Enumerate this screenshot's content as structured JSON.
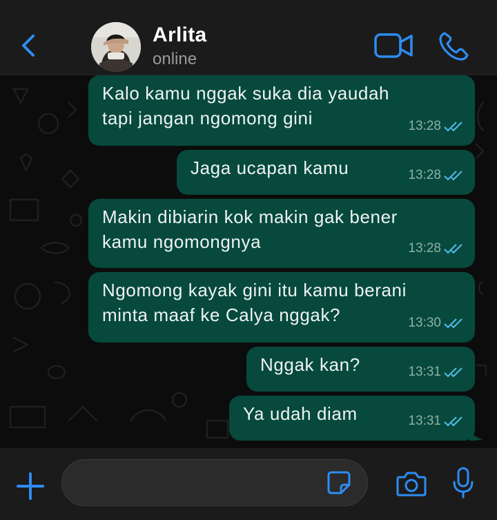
{
  "header": {
    "contact_name": "Arlita",
    "status": "online",
    "icons": {
      "back": "chevron-left-icon",
      "video": "video-camera-icon",
      "call": "phone-icon"
    }
  },
  "messages": [
    {
      "lines": [
        "Kalo kamu nggak suka dia yaudah",
        "tapi jangan ngomong gini"
      ],
      "time": "13:28",
      "status": "read"
    },
    {
      "lines": [
        "Jaga ucapan kamu"
      ],
      "time": "13:28",
      "status": "read"
    },
    {
      "lines": [
        "Makin dibiarin kok makin gak bener",
        "kamu ngomongnya"
      ],
      "time": "13:28",
      "status": "read"
    },
    {
      "lines": [
        "Ngomong kayak gini itu kamu berani",
        "minta maaf ke Calya nggak?"
      ],
      "time": "13:30",
      "status": "read"
    },
    {
      "lines": [
        "Nggak kan?"
      ],
      "time": "13:31",
      "status": "read"
    },
    {
      "lines": [
        "Ya udah diam"
      ],
      "time": "13:31",
      "status": "read"
    }
  ],
  "input_bar": {
    "message_value": "",
    "icons": {
      "attach": "plus-icon",
      "sticker": "sticker-icon",
      "camera": "camera-icon",
      "mic": "microphone-icon"
    }
  },
  "colors": {
    "accent": "#2d8df2",
    "outgoing_bubble": "#07493d",
    "header_bg": "#1b1b1b",
    "read_ticks": "#53bdeb"
  }
}
